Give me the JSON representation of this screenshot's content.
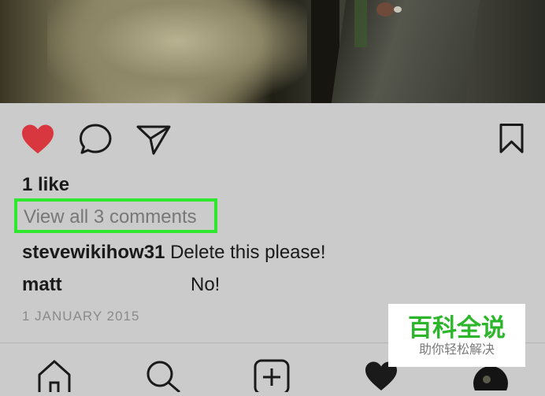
{
  "post": {
    "likes_text": "1 like",
    "view_comments_text": "View all 3 comments",
    "comments": [
      {
        "user": "stevewikihow31",
        "text": "Delete this please!"
      },
      {
        "user": "matt",
        "text": "No!"
      }
    ],
    "date_text": "1 JANUARY 2015"
  },
  "icons": {
    "like": "heart-filled-icon",
    "comment": "comment-bubble-icon",
    "share": "paper-plane-icon",
    "save": "bookmark-icon"
  },
  "tabbar": {
    "tabs": [
      "home-icon",
      "search-icon",
      "add-post-icon",
      "activity-heart-icon",
      "profile-avatar"
    ]
  },
  "watermark": {
    "title": "百科全说",
    "subtitle": "助你轻松解决"
  },
  "colors": {
    "like_red": "#d9373f",
    "highlight_green": "#2ee82e",
    "watermark_green": "#2db52b",
    "background": "#cbcbcb"
  }
}
